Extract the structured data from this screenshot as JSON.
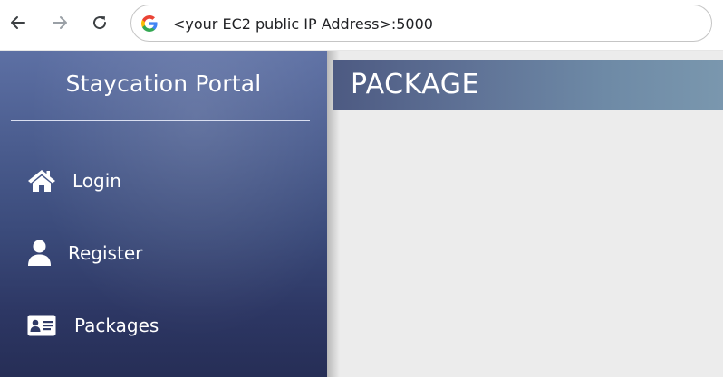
{
  "browser": {
    "url": "<your EC2 public IP Address>:5000",
    "icons": {
      "back": "back-arrow-icon",
      "forward": "forward-arrow-icon",
      "reload": "reload-icon",
      "search_engine": "google-icon"
    }
  },
  "sidebar": {
    "title": "Staycation Portal",
    "items": [
      {
        "label": "Login",
        "icon": "home-icon"
      },
      {
        "label": "Register",
        "icon": "user-icon"
      },
      {
        "label": "Packages",
        "icon": "id-card-icon"
      }
    ]
  },
  "main": {
    "header_title": "PACKAGE"
  },
  "colors": {
    "sidebar_top": "#5d70a4",
    "sidebar_bottom": "#262e56",
    "content_bg": "#ececec",
    "header_bg": "#5f7296"
  }
}
